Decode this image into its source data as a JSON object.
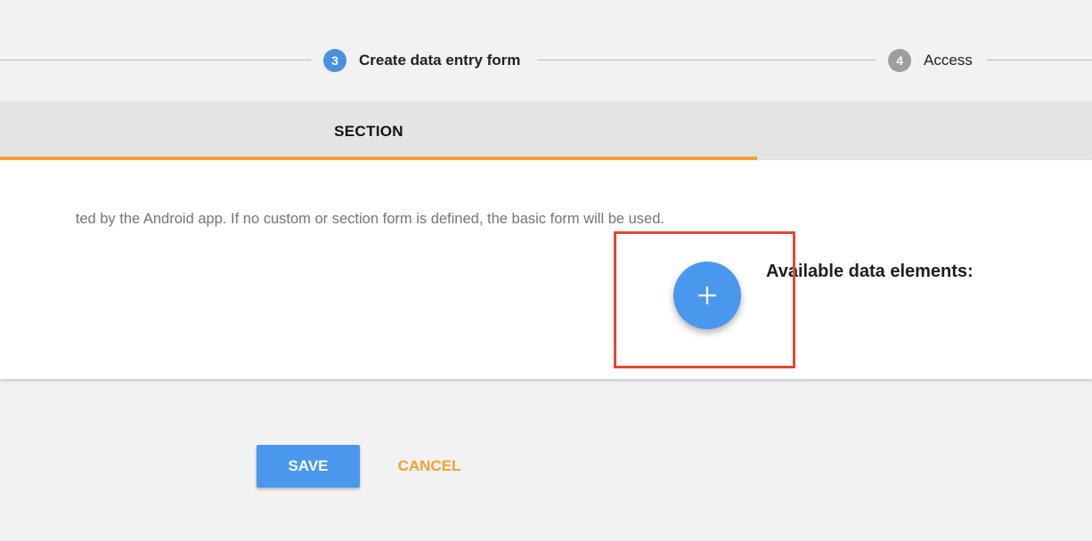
{
  "stepper": {
    "steps": [
      {
        "number": "3",
        "label": "Create data entry form",
        "state": "active"
      },
      {
        "number": "4",
        "label": "Access",
        "state": "inactive"
      }
    ]
  },
  "tabs": {
    "active_label": "SECTION"
  },
  "content": {
    "help_text": "ted by the Android app. If no custom or section form is defined, the basic form will be used.",
    "add_icon": "plus-icon",
    "available_title": "Available data elements:"
  },
  "actions": {
    "save_label": "SAVE",
    "cancel_label": "CANCEL"
  },
  "colors": {
    "active_step": "#4a90e2",
    "inactive_step": "#9e9e9e",
    "tab_indicator": "#f5a033",
    "fab": "#4a98ed",
    "highlight": "#e04a30",
    "save_button": "#4a98ed",
    "cancel_text": "#f5a033"
  }
}
